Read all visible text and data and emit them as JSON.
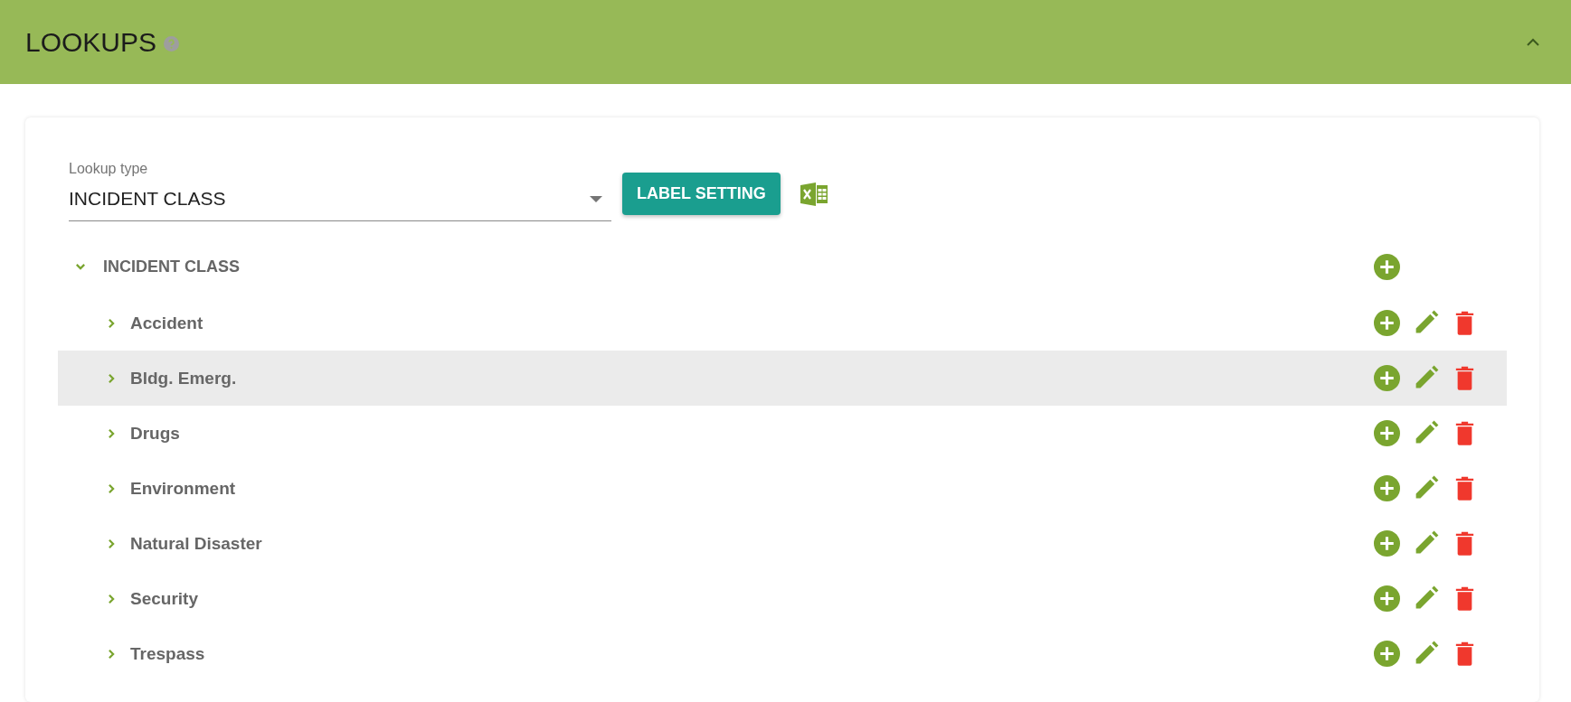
{
  "header": {
    "title": "LOOKUPS",
    "collapsed": false
  },
  "lookup_type": {
    "label": "Lookup type",
    "value": "INCIDENT CLASS"
  },
  "label_setting_button": "LABEL SETTING",
  "tree": [
    {
      "label": "INCIDENT CLASS",
      "expanded": true,
      "selected": false,
      "editable": false,
      "deletable": false,
      "children": [
        {
          "label": "Accident",
          "expanded": false,
          "selected": false,
          "editable": true,
          "deletable": true
        },
        {
          "label": "Bldg. Emerg.",
          "expanded": false,
          "selected": true,
          "editable": true,
          "deletable": true
        },
        {
          "label": "Drugs",
          "expanded": false,
          "selected": false,
          "editable": true,
          "deletable": true
        },
        {
          "label": "Environment",
          "expanded": false,
          "selected": false,
          "editable": true,
          "deletable": true
        },
        {
          "label": "Natural Disaster",
          "expanded": false,
          "selected": false,
          "editable": true,
          "deletable": true
        },
        {
          "label": "Security",
          "expanded": false,
          "selected": false,
          "editable": true,
          "deletable": true
        },
        {
          "label": "Trespass",
          "expanded": false,
          "selected": false,
          "editable": true,
          "deletable": true
        }
      ]
    }
  ]
}
